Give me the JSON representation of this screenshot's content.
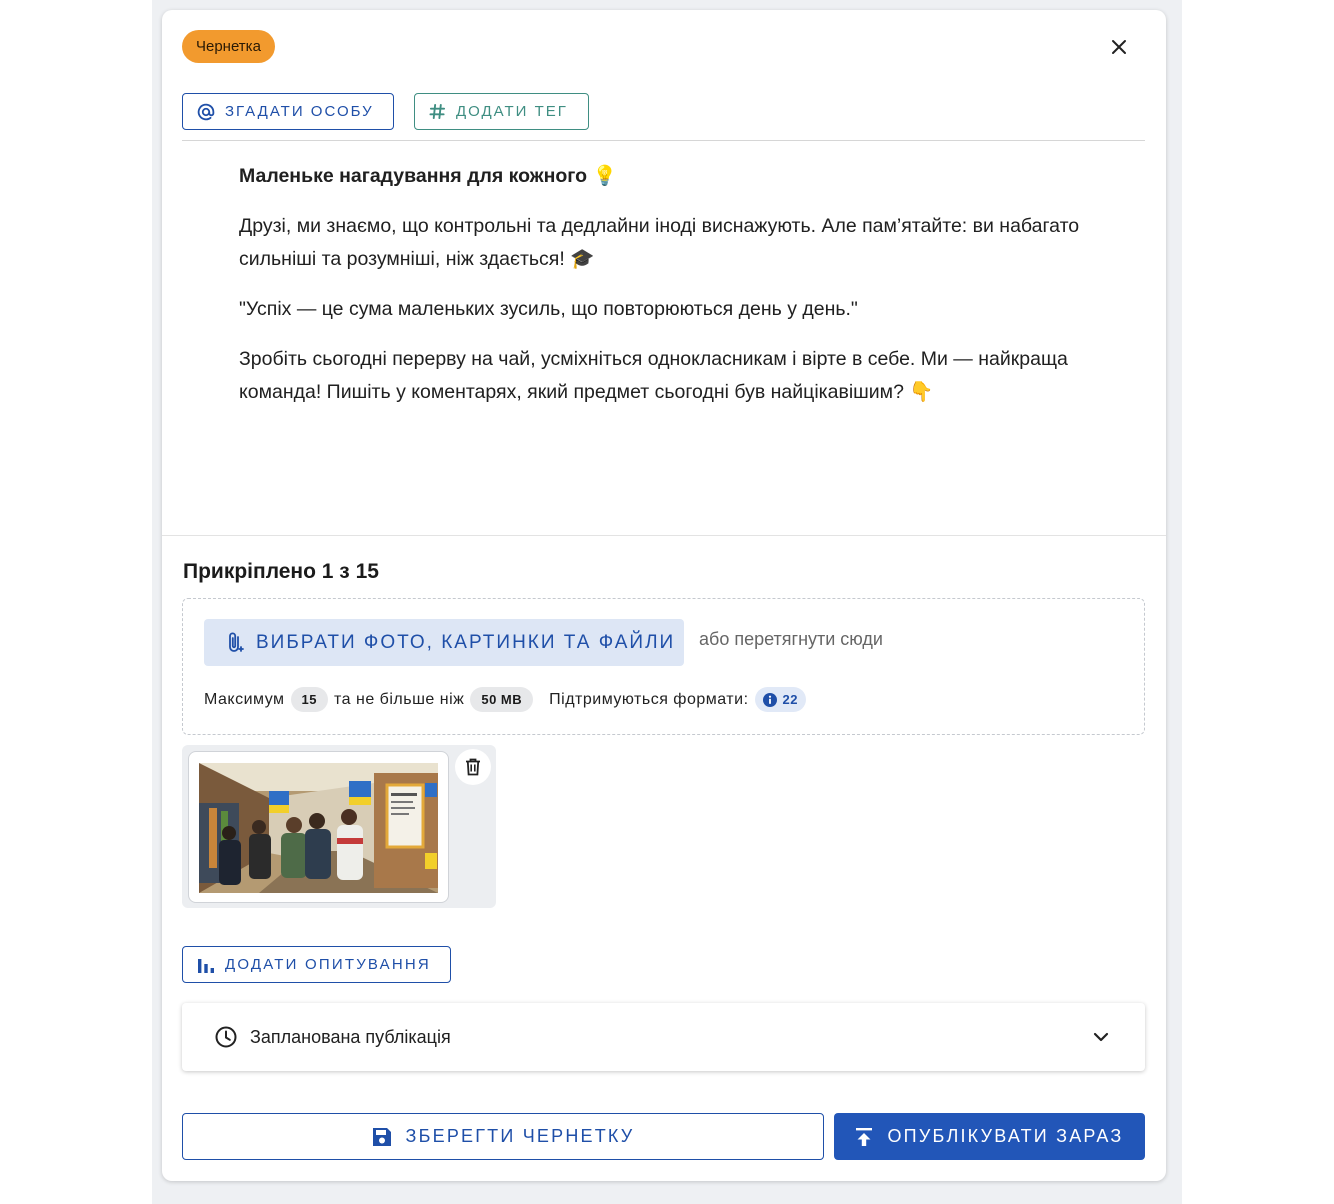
{
  "status_badge": "Чернетка",
  "toolbar": {
    "mention_label": "Згадати особу",
    "tag_label": "Додати тег"
  },
  "post": {
    "heading": "Маленьке нагадування для кожного 💡",
    "paragraphs": [
      "Друзі, ми знаємо, що контрольні та дедлайни іноді виснажують. Але пам’ятайте: ви набагато сильніші та розумніші, ніж здається! 🎓",
      "\"Успіх — це сума маленьких зусиль, що повторюються день у день.\"",
      "Зробіть сьогодні перерву на чай, усміхніться однокласникам і вірте в себе. Ми — найкраща команда! Пишіть у коментарях, який предмет сьогодні був найцікавішим? 👇"
    ]
  },
  "attachments": {
    "title": "Прикріплено 1 з 15",
    "pick_label": "Вибрати фото, картинки та файли",
    "drag_hint": "або перетягнути сюди",
    "max_label": "Максимум",
    "max_count": "15",
    "size_label": "та не більше ніж",
    "max_size": "50 MB",
    "formats_label": "Підтримуються формати:",
    "formats_count": "22"
  },
  "poll_label": "Додати опитування",
  "schedule_label": "Запланована публікація",
  "footer": {
    "save_label": "Зберегти чернетку",
    "publish_label": "Опублікувати зараз"
  },
  "colors": {
    "primary": "#1f4fa8",
    "publish": "#2256b8",
    "tag": "#3f8e82",
    "badge": "#f29a2e"
  },
  "icons": [
    "close-icon",
    "at-icon",
    "hash-icon",
    "lightbulb-icon",
    "graduation-cap-icon",
    "pointing-down-icon",
    "paperclip-icon",
    "info-icon",
    "trash-icon",
    "bar-chart-icon",
    "clock-icon",
    "chevron-down-icon",
    "save-icon",
    "upload-icon"
  ]
}
